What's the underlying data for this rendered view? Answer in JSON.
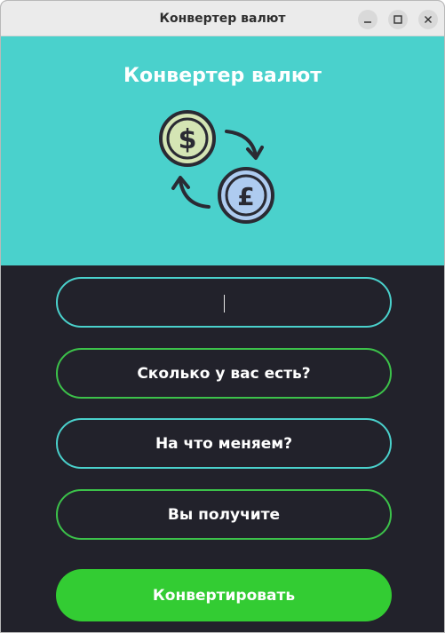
{
  "window": {
    "title": "Конвертер валют"
  },
  "header": {
    "title": "Конвертер валют",
    "icon": "currency-exchange-icon"
  },
  "form": {
    "amount_value": "",
    "have_label": "Сколько у вас есть?",
    "to_label": "На что меняем?",
    "receive_label": "Вы получите",
    "convert_label": "Конвертировать"
  },
  "colors": {
    "header_bg": "#4ad1cc",
    "body_bg": "#22222b",
    "cyan_border": "#4ad1cc",
    "green_border": "#3cc24a",
    "convert_bg": "#33cc33"
  }
}
